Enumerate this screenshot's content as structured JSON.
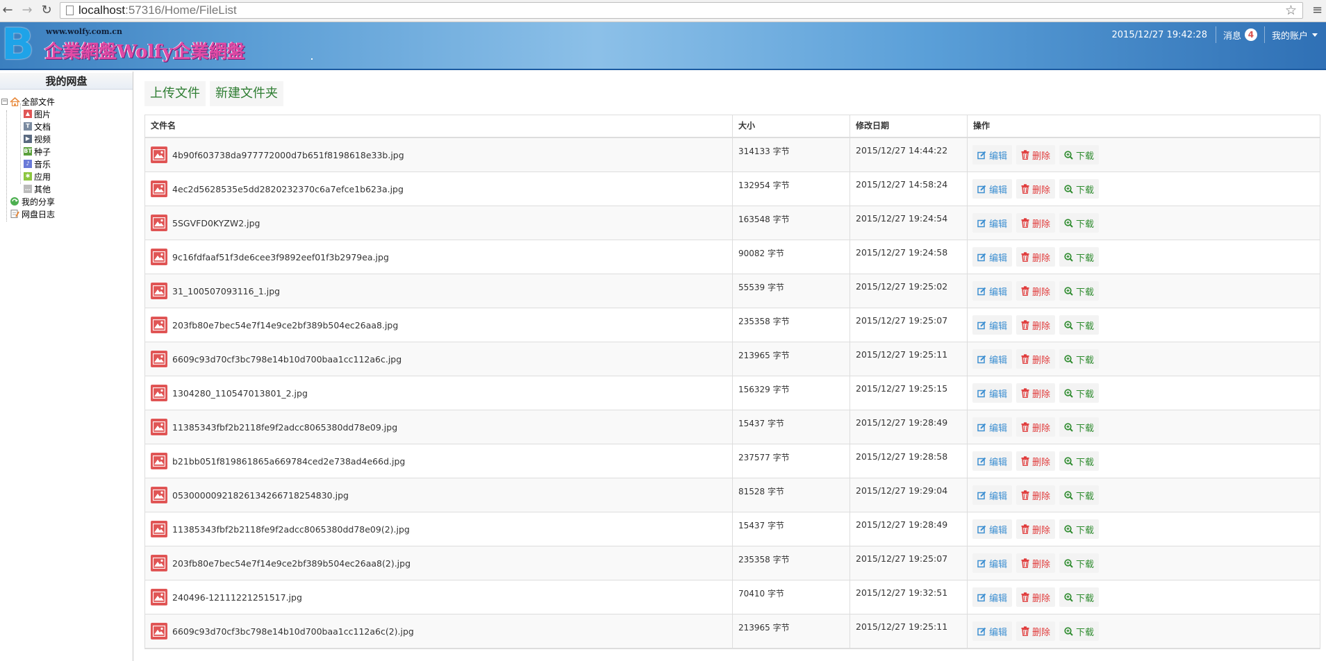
{
  "browser": {
    "url_host": "localhost",
    "url_path": ":57316/Home/FileList"
  },
  "header": {
    "logo_letter": "B",
    "logo_url": "www.wolfy.com.cn",
    "logo_title": "企業網盤Wolfy企業網盤",
    "datetime": "2015/12/27 19:42:28",
    "messages_label": "消息",
    "messages_count": "4",
    "account_label": "我的账户"
  },
  "sidebar": {
    "title": "我的网盘",
    "root_label": "全部文件",
    "items": [
      {
        "label": "图片",
        "icon": "image-icon",
        "color": "#e05555",
        "glyph": "▲"
      },
      {
        "label": "文档",
        "icon": "document-icon",
        "color": "#7a8aa0",
        "glyph": "T"
      },
      {
        "label": "视频",
        "icon": "video-icon",
        "color": "#5a6a80",
        "glyph": "▶"
      },
      {
        "label": "种子",
        "icon": "torrent-icon",
        "color": "#5aa03a",
        "glyph": "BT"
      },
      {
        "label": "音乐",
        "icon": "music-icon",
        "color": "#6a7ad8",
        "glyph": "♪"
      },
      {
        "label": "应用",
        "icon": "app-icon",
        "color": "#8cc63f",
        "glyph": "✱"
      },
      {
        "label": "其他",
        "icon": "other-icon",
        "color": "#bbbbbb",
        "glyph": "…"
      }
    ],
    "share_label": "我的分享",
    "log_label": "网盘日志"
  },
  "toolbar": {
    "upload_label": "上传文件",
    "new_folder_label": "新建文件夹"
  },
  "table": {
    "headers": [
      "文件名",
      "大小",
      "修改日期",
      "操作"
    ],
    "edit_label": "编辑",
    "delete_label": "删除",
    "download_label": "下载",
    "rows": [
      {
        "name": "4b90f603738da977772000d7b651f8198618e33b.jpg",
        "size": "314133 字节",
        "date": "2015/12/27 14:44:22"
      },
      {
        "name": "4ec2d5628535e5dd2820232370c6a7efce1b623a.jpg",
        "size": "132954 字节",
        "date": "2015/12/27 14:58:24"
      },
      {
        "name": "5SGVFD0KYZW2.jpg",
        "size": "163548 字节",
        "date": "2015/12/27 19:24:54"
      },
      {
        "name": "9c16fdfaaf51f3de6cee3f9892eef01f3b2979ea.jpg",
        "size": "90082 字节",
        "date": "2015/12/27 19:24:58"
      },
      {
        "name": "31_100507093116_1.jpg",
        "size": "55539 字节",
        "date": "2015/12/27 19:25:02"
      },
      {
        "name": "203fb80e7bec54e7f14e9ce2bf389b504ec26aa8.jpg",
        "size": "235358 字节",
        "date": "2015/12/27 19:25:07"
      },
      {
        "name": "6609c93d70cf3bc798e14b10d700baa1cc112a6c.jpg",
        "size": "213965 字节",
        "date": "2015/12/27 19:25:11"
      },
      {
        "name": "1304280_110547013801_2.jpg",
        "size": "156329 字节",
        "date": "2015/12/27 19:25:15"
      },
      {
        "name": "11385343fbf2b2118fe9f2adcc8065380dd78e09.jpg",
        "size": "15437 字节",
        "date": "2015/12/27 19:28:49"
      },
      {
        "name": "b21bb051f819861865a669784ced2e738ad4e66d.jpg",
        "size": "237577 字节",
        "date": "2015/12/27 19:28:58"
      },
      {
        "name": "05300000921826134266718254830.jpg",
        "size": "81528 字节",
        "date": "2015/12/27 19:29:04"
      },
      {
        "name": "11385343fbf2b2118fe9f2adcc8065380dd78e09(2).jpg",
        "size": "15437 字节",
        "date": "2015/12/27 19:28:49"
      },
      {
        "name": "203fb80e7bec54e7f14e9ce2bf389b504ec26aa8(2).jpg",
        "size": "235358 字节",
        "date": "2015/12/27 19:25:07"
      },
      {
        "name": "240496-12111221251517.jpg",
        "size": "70410 字节",
        "date": "2015/12/27 19:32:51"
      },
      {
        "name": "6609c93d70cf3bc798e14b10d700baa1cc112a6c(2).jpg",
        "size": "213965 字节",
        "date": "2015/12/27 19:25:11"
      }
    ]
  },
  "colors": {
    "edit": "#3d8fd1",
    "delete": "#e03a3a",
    "download": "#2e8b2e",
    "file_icon": "#e05555"
  }
}
